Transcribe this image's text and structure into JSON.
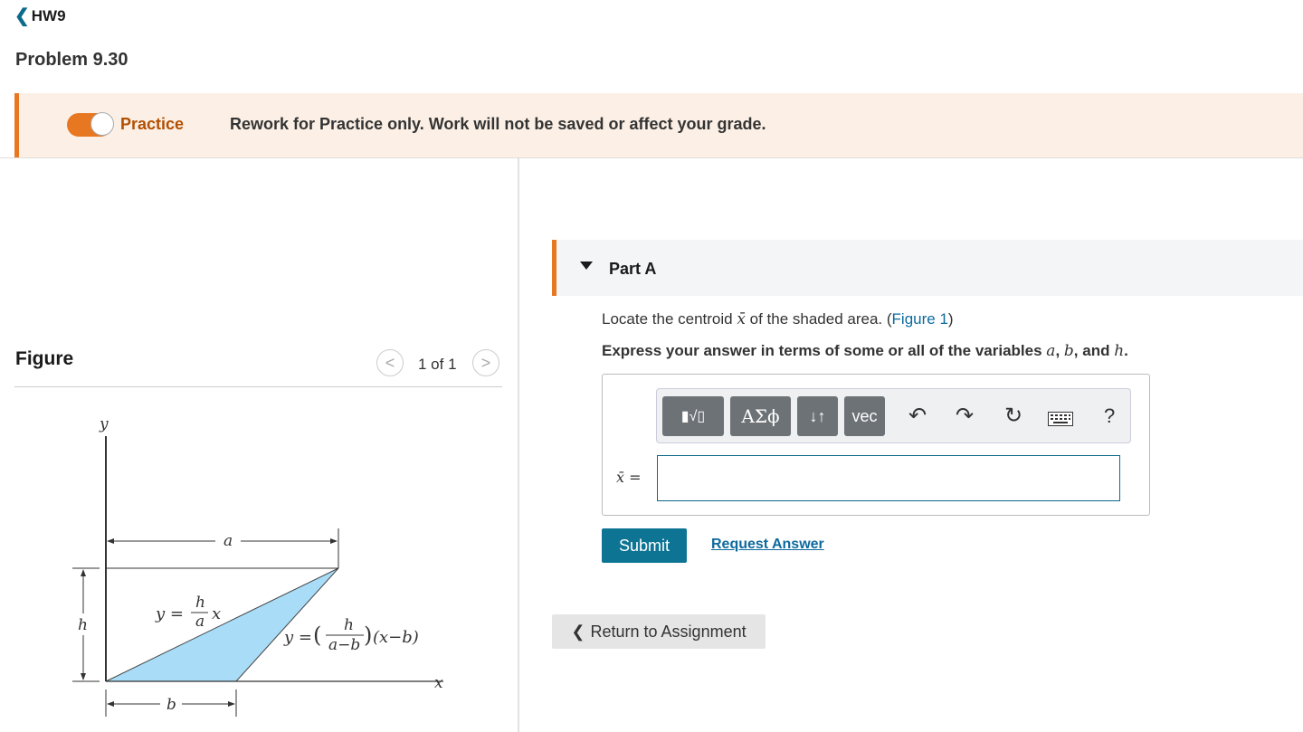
{
  "nav": {
    "back_label": "HW9"
  },
  "problem": {
    "title": "Problem 9.30"
  },
  "banner": {
    "practice_label": "Practice",
    "message": "Rework for Practice only. Work will not be saved or affect your grade.",
    "toggle_on": true
  },
  "figure": {
    "heading": "Figure",
    "counter": "1 of 1",
    "labels": {
      "y_axis": "y",
      "x_axis": "x",
      "a": "a",
      "b": "b",
      "h": "h",
      "eq1_lhs": "y =",
      "eq1_num": "h",
      "eq1_den": "a",
      "eq1_var": "x",
      "eq2_lhs": "y =",
      "eq2_num": "h",
      "eq2_den": "a−b",
      "eq2_tail": "(x−b)"
    }
  },
  "part_a": {
    "title": "Part A",
    "question_prefix": "Locate the centroid ",
    "question_var": "x̄",
    "question_mid": " of the shaded area. (",
    "figure_link": "Figure 1",
    "question_suffix": ")",
    "instruction_prefix": "Express your answer in terms of some or all of the variables ",
    "var_a": "a",
    "var_b": "b",
    "var_h": "h",
    "instruction_and": " and ",
    "answer_label": "x̄ =",
    "answer_value": ""
  },
  "toolbar": {
    "templates_label": "▮√▯",
    "symbols_label": "ΑΣϕ",
    "updown_label": "↓↑",
    "vec_label": "vec",
    "undo_icon": "↶",
    "redo_icon": "↷",
    "reset_icon": "↻",
    "keyboard_icon": "⌨",
    "help_label": "?"
  },
  "actions": {
    "submit_label": "Submit",
    "request_answer_label": "Request Answer",
    "return_label": "Return to Assignment"
  },
  "colors": {
    "accent_orange": "#e87722",
    "teal": "#0e7494",
    "shaded_area": "#a8dcf7"
  }
}
